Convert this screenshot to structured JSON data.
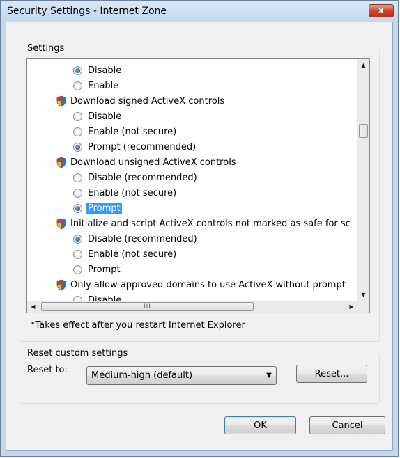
{
  "window": {
    "title": "Security Settings - Internet Zone",
    "close_glyph": "x"
  },
  "settings": {
    "group_label": "Settings",
    "rows": [
      {
        "kind": "radio",
        "label": "Disable",
        "checked": true
      },
      {
        "kind": "radio",
        "label": "Enable",
        "checked": false
      },
      {
        "kind": "heading",
        "label": "Download signed ActiveX controls",
        "icon": "shield-icon"
      },
      {
        "kind": "radio",
        "label": "Disable",
        "checked": false
      },
      {
        "kind": "radio",
        "label": "Enable (not secure)",
        "checked": false
      },
      {
        "kind": "radio",
        "label": "Prompt (recommended)",
        "checked": true
      },
      {
        "kind": "heading",
        "label": "Download unsigned ActiveX controls",
        "icon": "shield-icon"
      },
      {
        "kind": "radio",
        "label": "Disable (recommended)",
        "checked": false
      },
      {
        "kind": "radio",
        "label": "Enable (not secure)",
        "checked": false
      },
      {
        "kind": "radio",
        "label": "Prompt",
        "checked": true,
        "selected": true
      },
      {
        "kind": "heading",
        "label": "Initialize and script ActiveX controls not marked as safe for sc",
        "icon": "shield-icon"
      },
      {
        "kind": "radio",
        "label": "Disable (recommended)",
        "checked": true
      },
      {
        "kind": "radio",
        "label": "Enable (not secure)",
        "checked": false
      },
      {
        "kind": "radio",
        "label": "Prompt",
        "checked": false
      },
      {
        "kind": "heading",
        "label": "Only allow approved domains to use ActiveX without prompt",
        "icon": "shield-icon"
      },
      {
        "kind": "radio",
        "label": "Disable",
        "checked": false
      }
    ],
    "hscroll_grip": "III",
    "note": "*Takes effect after you restart Internet Explorer"
  },
  "reset": {
    "group_label": "Reset custom settings",
    "reset_to_label": "Reset to:",
    "selected_level": "Medium-high (default)",
    "reset_button": "Reset..."
  },
  "footer": {
    "ok": "OK",
    "cancel": "Cancel"
  },
  "colors": {
    "selection": "#3399ff",
    "close_button": "#c7442a",
    "frame": "#c3d7ee"
  }
}
